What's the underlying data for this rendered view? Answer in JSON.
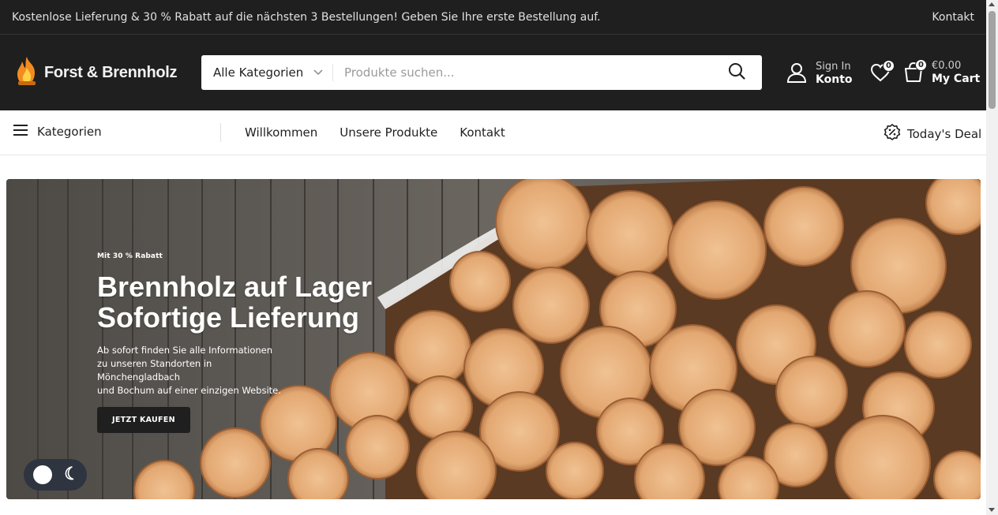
{
  "topbar": {
    "promo": "Kostenlose Lieferung & 30 % Rabatt auf die nächsten 3 Bestellungen! Geben Sie Ihre erste Bestellung auf.",
    "contact": "Kontakt"
  },
  "header": {
    "logo_text": "Forst & Brennholz",
    "logo_icon": "flame-logo-icon",
    "search": {
      "category": "Alle Kategorien",
      "placeholder": "Produkte suchen...",
      "icon": "search-icon"
    },
    "account": {
      "small": "Sign In",
      "big": "Konto",
      "icon": "user-icon"
    },
    "wishlist": {
      "count": "0",
      "icon": "heart-icon"
    },
    "cart": {
      "count": "0",
      "amount": "€0.00",
      "label": "My Cart",
      "icon": "cart-icon"
    }
  },
  "nav": {
    "categories_label": "Kategorien",
    "links": [
      "Willkommen",
      "Unsere Produkte",
      "Kontakt"
    ],
    "deal_label": "Today's Deal"
  },
  "hero": {
    "subtitle": "Mit 30 % Rabatt",
    "title_line1": "Brennholz auf Lager",
    "title_line2": "Sofortige Lieferung",
    "desc_line1": "Ab sofort finden Sie alle Informationen",
    "desc_line2": "zu unseren Standorten in Mönchengladbach",
    "desc_line3": "und Bochum auf einer einzigen Website.",
    "button": "JETZT KAUFEN"
  },
  "colors": {
    "dark": "#1f1f1f",
    "wood": "#e8b88a",
    "fence": "#6f6a64"
  }
}
